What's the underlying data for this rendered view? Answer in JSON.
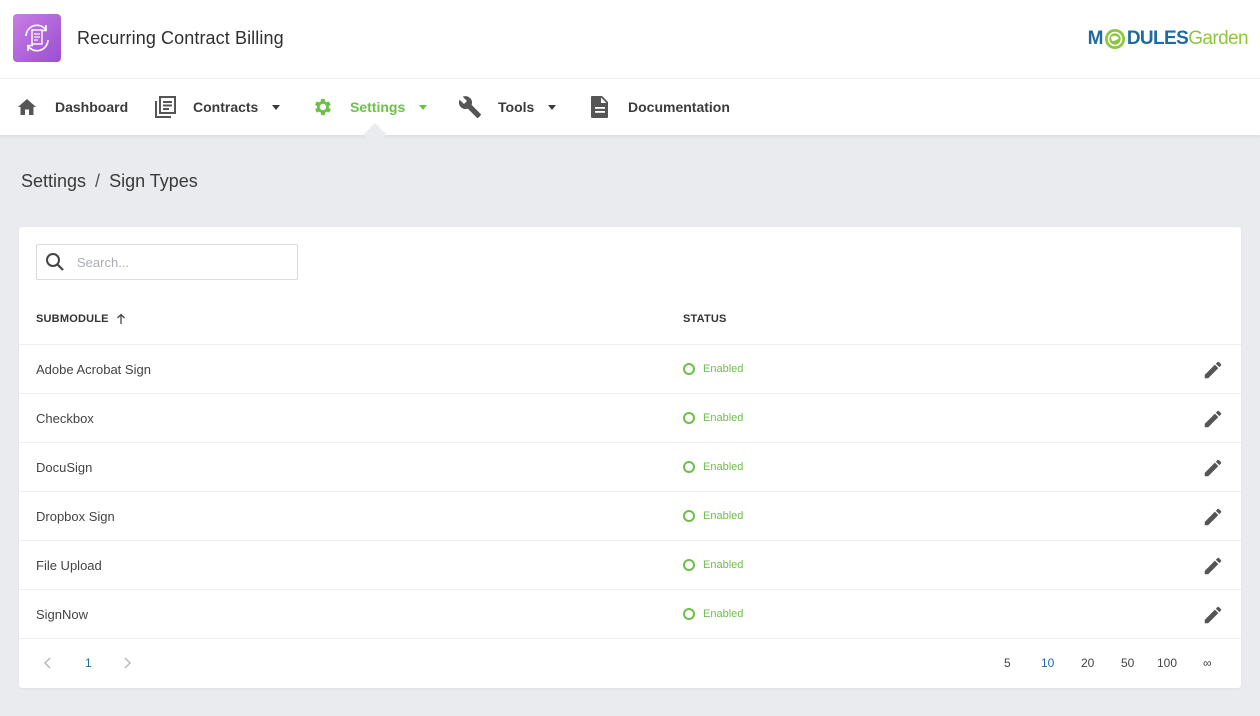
{
  "header": {
    "app_title": "Recurring Contract Billing",
    "brand_part1": "M",
    "brand_part2": "DULES",
    "brand_part3": "Garden",
    "app_logo_color": "#b667de",
    "brand_primary": "#1f6aa0",
    "brand_accent": "#8dc63f"
  },
  "nav": {
    "items": [
      {
        "label": "Dashboard",
        "icon": "home-icon"
      },
      {
        "label": "Contracts",
        "icon": "contracts-icon",
        "dropdown": true
      },
      {
        "label": "Settings",
        "icon": "gear-icon",
        "dropdown": true,
        "active": true
      },
      {
        "label": "Tools",
        "icon": "wrench-icon",
        "dropdown": true
      },
      {
        "label": "Documentation",
        "icon": "document-icon"
      }
    ],
    "active_color": "#6cc04a"
  },
  "breadcrumb": {
    "parent": "Settings",
    "separator": "/",
    "current": "Sign Types"
  },
  "table": {
    "search_placeholder": "Search...",
    "columns": {
      "submodule": "SUBMODULE",
      "status": "STATUS"
    },
    "sort": "ascending",
    "rows": [
      {
        "name": "Adobe Acrobat Sign",
        "status": "Enabled"
      },
      {
        "name": "Checkbox",
        "status": "Enabled"
      },
      {
        "name": "DocuSign",
        "status": "Enabled"
      },
      {
        "name": "Dropbox Sign",
        "status": "Enabled"
      },
      {
        "name": "File Upload",
        "status": "Enabled"
      },
      {
        "name": "SignNow",
        "status": "Enabled"
      }
    ],
    "status_color": "#6cc04a"
  },
  "pagination": {
    "current_page": "1",
    "page_sizes": [
      "5",
      "10",
      "20",
      "50",
      "100",
      "∞"
    ],
    "selected_page_size": "10"
  }
}
